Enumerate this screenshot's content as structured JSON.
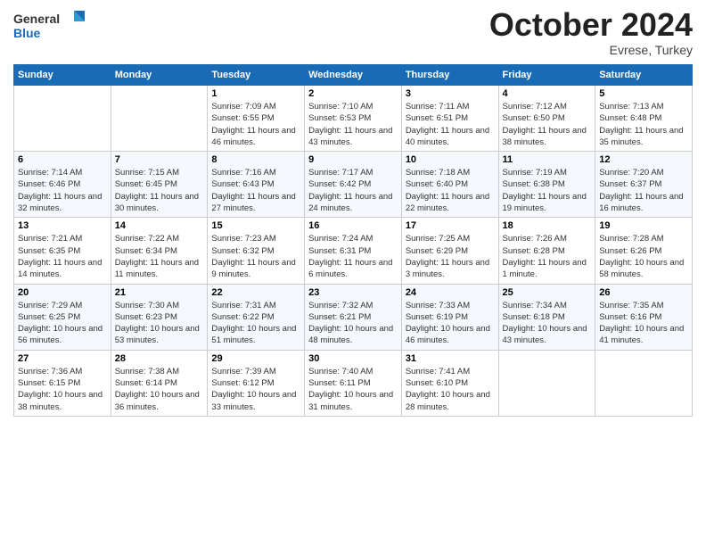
{
  "header": {
    "logo": {
      "line1": "General",
      "line2": "Blue"
    },
    "month_year": "October 2024",
    "location": "Evrese, Turkey"
  },
  "weekdays": [
    "Sunday",
    "Monday",
    "Tuesday",
    "Wednesday",
    "Thursday",
    "Friday",
    "Saturday"
  ],
  "weeks": [
    [
      {
        "day": null
      },
      {
        "day": null
      },
      {
        "day": "1",
        "sunrise": "Sunrise: 7:09 AM",
        "sunset": "Sunset: 6:55 PM",
        "daylight": "Daylight: 11 hours and 46 minutes."
      },
      {
        "day": "2",
        "sunrise": "Sunrise: 7:10 AM",
        "sunset": "Sunset: 6:53 PM",
        "daylight": "Daylight: 11 hours and 43 minutes."
      },
      {
        "day": "3",
        "sunrise": "Sunrise: 7:11 AM",
        "sunset": "Sunset: 6:51 PM",
        "daylight": "Daylight: 11 hours and 40 minutes."
      },
      {
        "day": "4",
        "sunrise": "Sunrise: 7:12 AM",
        "sunset": "Sunset: 6:50 PM",
        "daylight": "Daylight: 11 hours and 38 minutes."
      },
      {
        "day": "5",
        "sunrise": "Sunrise: 7:13 AM",
        "sunset": "Sunset: 6:48 PM",
        "daylight": "Daylight: 11 hours and 35 minutes."
      }
    ],
    [
      {
        "day": "6",
        "sunrise": "Sunrise: 7:14 AM",
        "sunset": "Sunset: 6:46 PM",
        "daylight": "Daylight: 11 hours and 32 minutes."
      },
      {
        "day": "7",
        "sunrise": "Sunrise: 7:15 AM",
        "sunset": "Sunset: 6:45 PM",
        "daylight": "Daylight: 11 hours and 30 minutes."
      },
      {
        "day": "8",
        "sunrise": "Sunrise: 7:16 AM",
        "sunset": "Sunset: 6:43 PM",
        "daylight": "Daylight: 11 hours and 27 minutes."
      },
      {
        "day": "9",
        "sunrise": "Sunrise: 7:17 AM",
        "sunset": "Sunset: 6:42 PM",
        "daylight": "Daylight: 11 hours and 24 minutes."
      },
      {
        "day": "10",
        "sunrise": "Sunrise: 7:18 AM",
        "sunset": "Sunset: 6:40 PM",
        "daylight": "Daylight: 11 hours and 22 minutes."
      },
      {
        "day": "11",
        "sunrise": "Sunrise: 7:19 AM",
        "sunset": "Sunset: 6:38 PM",
        "daylight": "Daylight: 11 hours and 19 minutes."
      },
      {
        "day": "12",
        "sunrise": "Sunrise: 7:20 AM",
        "sunset": "Sunset: 6:37 PM",
        "daylight": "Daylight: 11 hours and 16 minutes."
      }
    ],
    [
      {
        "day": "13",
        "sunrise": "Sunrise: 7:21 AM",
        "sunset": "Sunset: 6:35 PM",
        "daylight": "Daylight: 11 hours and 14 minutes."
      },
      {
        "day": "14",
        "sunrise": "Sunrise: 7:22 AM",
        "sunset": "Sunset: 6:34 PM",
        "daylight": "Daylight: 11 hours and 11 minutes."
      },
      {
        "day": "15",
        "sunrise": "Sunrise: 7:23 AM",
        "sunset": "Sunset: 6:32 PM",
        "daylight": "Daylight: 11 hours and 9 minutes."
      },
      {
        "day": "16",
        "sunrise": "Sunrise: 7:24 AM",
        "sunset": "Sunset: 6:31 PM",
        "daylight": "Daylight: 11 hours and 6 minutes."
      },
      {
        "day": "17",
        "sunrise": "Sunrise: 7:25 AM",
        "sunset": "Sunset: 6:29 PM",
        "daylight": "Daylight: 11 hours and 3 minutes."
      },
      {
        "day": "18",
        "sunrise": "Sunrise: 7:26 AM",
        "sunset": "Sunset: 6:28 PM",
        "daylight": "Daylight: 11 hours and 1 minute."
      },
      {
        "day": "19",
        "sunrise": "Sunrise: 7:28 AM",
        "sunset": "Sunset: 6:26 PM",
        "daylight": "Daylight: 10 hours and 58 minutes."
      }
    ],
    [
      {
        "day": "20",
        "sunrise": "Sunrise: 7:29 AM",
        "sunset": "Sunset: 6:25 PM",
        "daylight": "Daylight: 10 hours and 56 minutes."
      },
      {
        "day": "21",
        "sunrise": "Sunrise: 7:30 AM",
        "sunset": "Sunset: 6:23 PM",
        "daylight": "Daylight: 10 hours and 53 minutes."
      },
      {
        "day": "22",
        "sunrise": "Sunrise: 7:31 AM",
        "sunset": "Sunset: 6:22 PM",
        "daylight": "Daylight: 10 hours and 51 minutes."
      },
      {
        "day": "23",
        "sunrise": "Sunrise: 7:32 AM",
        "sunset": "Sunset: 6:21 PM",
        "daylight": "Daylight: 10 hours and 48 minutes."
      },
      {
        "day": "24",
        "sunrise": "Sunrise: 7:33 AM",
        "sunset": "Sunset: 6:19 PM",
        "daylight": "Daylight: 10 hours and 46 minutes."
      },
      {
        "day": "25",
        "sunrise": "Sunrise: 7:34 AM",
        "sunset": "Sunset: 6:18 PM",
        "daylight": "Daylight: 10 hours and 43 minutes."
      },
      {
        "day": "26",
        "sunrise": "Sunrise: 7:35 AM",
        "sunset": "Sunset: 6:16 PM",
        "daylight": "Daylight: 10 hours and 41 minutes."
      }
    ],
    [
      {
        "day": "27",
        "sunrise": "Sunrise: 7:36 AM",
        "sunset": "Sunset: 6:15 PM",
        "daylight": "Daylight: 10 hours and 38 minutes."
      },
      {
        "day": "28",
        "sunrise": "Sunrise: 7:38 AM",
        "sunset": "Sunset: 6:14 PM",
        "daylight": "Daylight: 10 hours and 36 minutes."
      },
      {
        "day": "29",
        "sunrise": "Sunrise: 7:39 AM",
        "sunset": "Sunset: 6:12 PM",
        "daylight": "Daylight: 10 hours and 33 minutes."
      },
      {
        "day": "30",
        "sunrise": "Sunrise: 7:40 AM",
        "sunset": "Sunset: 6:11 PM",
        "daylight": "Daylight: 10 hours and 31 minutes."
      },
      {
        "day": "31",
        "sunrise": "Sunrise: 7:41 AM",
        "sunset": "Sunset: 6:10 PM",
        "daylight": "Daylight: 10 hours and 28 minutes."
      },
      {
        "day": null
      },
      {
        "day": null
      }
    ]
  ]
}
